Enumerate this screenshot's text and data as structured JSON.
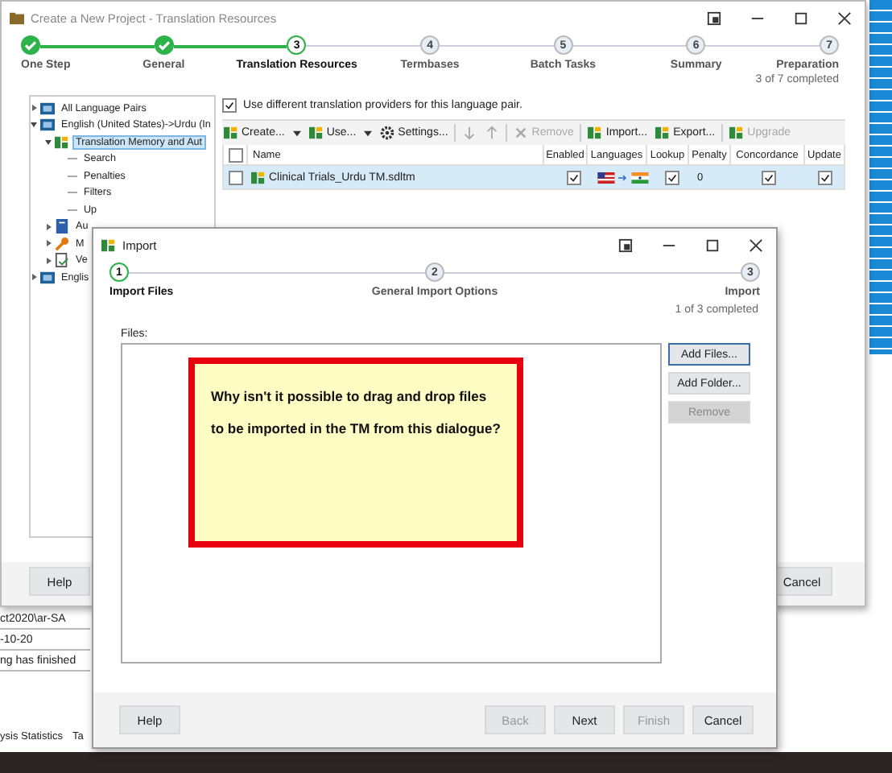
{
  "main_window": {
    "title": "Create a New Project - Translation Resources",
    "steps": [
      {
        "label": "One Step",
        "completed": true,
        "selected": false
      },
      {
        "label": "General",
        "completed": true,
        "selected": false
      },
      {
        "number": "3",
        "label": "Translation Resources",
        "completed": false,
        "selected": true
      },
      {
        "number": "4",
        "label": "Termbases",
        "completed": false,
        "selected": false
      },
      {
        "number": "5",
        "label": "Batch Tasks",
        "completed": false,
        "selected": false
      },
      {
        "number": "6",
        "label": "Summary",
        "completed": false,
        "selected": false
      },
      {
        "number": "7",
        "label": "Preparation",
        "completed": false,
        "selected": false
      }
    ],
    "progress": "3 of 7 completed",
    "tree": [
      {
        "label": "All Language Pairs",
        "kind": "pair",
        "expanded": false,
        "selected": false
      },
      {
        "label": "English (United States)->Urdu (In",
        "kind": "pair",
        "expanded": true,
        "selected": false,
        "children": [
          {
            "label": "Translation Memory and Aut",
            "kind": "tm",
            "expanded": true,
            "selected": true,
            "children": [
              {
                "label": "Search",
                "kind": "setting",
                "selected": false
              },
              {
                "label": "Penalties",
                "kind": "setting",
                "selected": false
              },
              {
                "label": "Filters",
                "kind": "setting",
                "selected": false
              },
              {
                "label": "Up",
                "kind": "setting",
                "selected": false
              }
            ]
          },
          {
            "label": "Au",
            "kind": "book",
            "expanded": false,
            "selected": false
          },
          {
            "label": "M",
            "kind": "wrench",
            "expanded": false,
            "selected": false
          },
          {
            "label": "Ve",
            "kind": "doc",
            "expanded": false,
            "selected": false
          }
        ]
      },
      {
        "label": "Englis",
        "kind": "pair",
        "expanded": false,
        "selected": false
      }
    ],
    "use_different_providers": {
      "label": "Use different translation providers for this language pair.",
      "checked": true
    },
    "toolbar": [
      {
        "kind": "dropdown",
        "label": "Create...",
        "disabled": false
      },
      {
        "kind": "dropdown",
        "label": "Use...",
        "disabled": false
      },
      {
        "kind": "gear",
        "label": "Settings...",
        "disabled": false
      },
      {
        "kind": "separator"
      },
      {
        "kind": "down",
        "disabled": true
      },
      {
        "kind": "up",
        "disabled": true
      },
      {
        "kind": "separator"
      },
      {
        "kind": "cross",
        "label": "Remove",
        "disabled": true
      },
      {
        "kind": "separator"
      },
      {
        "kind": "tm",
        "label": "Import...",
        "disabled": false
      },
      {
        "kind": "tm",
        "label": "Export...",
        "disabled": false
      },
      {
        "kind": "separator"
      },
      {
        "kind": "tm",
        "label": "Upgrade",
        "disabled": true
      }
    ],
    "table": {
      "select_all_checked": false,
      "columns": [
        "Name",
        "Enabled",
        "Languages",
        "Lookup",
        "Penalty",
        "Concordance",
        "Update"
      ],
      "rows": [
        {
          "checked": false,
          "selected": true,
          "name": "Clinical Trials_Urdu TM.sdltm",
          "enabled": true,
          "lookup": true,
          "penalty": "0",
          "concordance": true,
          "update": true
        }
      ]
    },
    "buttons": {
      "help": "Help",
      "cancel": "Cancel"
    }
  },
  "background_app": {
    "lines": [
      "ct2020\\ar-SA",
      "-10-20",
      "ng has finished"
    ],
    "tabs": [
      "ysis Statistics",
      "Ta"
    ]
  },
  "import_dialog": {
    "title": "Import",
    "steps": [
      {
        "number": "1",
        "label": "Import Files",
        "completed": false,
        "selected": true
      },
      {
        "number": "2",
        "label": "General Import Options",
        "completed": false,
        "selected": false
      },
      {
        "number": "3",
        "label": "Import",
        "completed": false,
        "selected": false
      }
    ],
    "progress": "1 of 3 completed",
    "files_label": "Files:",
    "side_buttons": [
      {
        "label": "Add Files...",
        "disabled": false,
        "focused": true
      },
      {
        "label": "Add Folder...",
        "disabled": false,
        "focused": false
      },
      {
        "label": "Remove",
        "disabled": true,
        "focused": false
      }
    ],
    "help_button": "Help",
    "nav_buttons": [
      {
        "label": "Back",
        "disabled": true
      },
      {
        "label": "Next",
        "disabled": false
      },
      {
        "label": "Finish",
        "disabled": true
      },
      {
        "label": "Cancel",
        "disabled": false
      }
    ]
  },
  "annotation": {
    "text": "Why isn't it possible to drag and drop files to be imported in the TM from this dialogue?"
  }
}
